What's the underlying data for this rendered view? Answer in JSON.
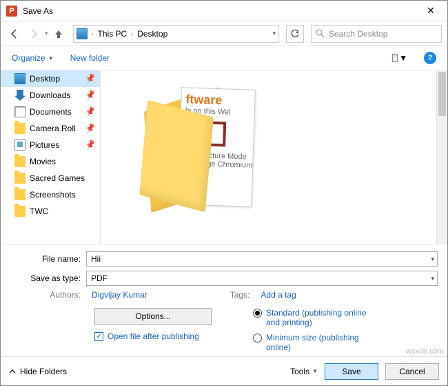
{
  "window": {
    "title": "Save As"
  },
  "nav": {
    "back_state": "enabled",
    "forward_state": "disabled",
    "crumb1": "This PC",
    "crumb2": "Desktop",
    "search_placeholder": "Search Desktop"
  },
  "toolbar": {
    "organize": "Organize",
    "newfolder": "New folder"
  },
  "sidebar": {
    "items": [
      {
        "label": "Desktop",
        "icon": "desktop",
        "pinned": true,
        "selected": true
      },
      {
        "label": "Downloads",
        "icon": "downloads",
        "pinned": true
      },
      {
        "label": "Documents",
        "icon": "docs",
        "pinned": true
      },
      {
        "label": "Camera Roll",
        "icon": "folder",
        "pinned": true
      },
      {
        "label": "Pictures",
        "icon": "pics",
        "pinned": true
      },
      {
        "label": "Movies",
        "icon": "folder"
      },
      {
        "label": "Sacred Games",
        "icon": "folder"
      },
      {
        "label": "Screenshots",
        "icon": "folder"
      },
      {
        "label": "TWC",
        "icon": "folder"
      }
    ]
  },
  "preview": {
    "hint1": "ftware",
    "hint2": "le on this Wel",
    "hint3": "re-In-Picture Mode",
    "hint4": "soft Edge Chromium"
  },
  "form": {
    "filename_label": "File name:",
    "filename_value": "Hii",
    "savetype_label": "Save as type:",
    "savetype_value": "PDF",
    "authors_label": "Authors:",
    "authors_value": "Digvijay Kumar",
    "tags_label": "Tags:",
    "tags_value": "Add a tag",
    "options_button": "Options...",
    "openafter": "Open file after publishing",
    "radio_standard": "Standard (publishing online and printing)",
    "radio_minimum": "Minimum size (publishing online)"
  },
  "footer": {
    "hidefolders": "Hide Folders",
    "tools": "Tools",
    "save": "Save",
    "cancel": "Cancel"
  },
  "watermark": "wsxdn.com"
}
